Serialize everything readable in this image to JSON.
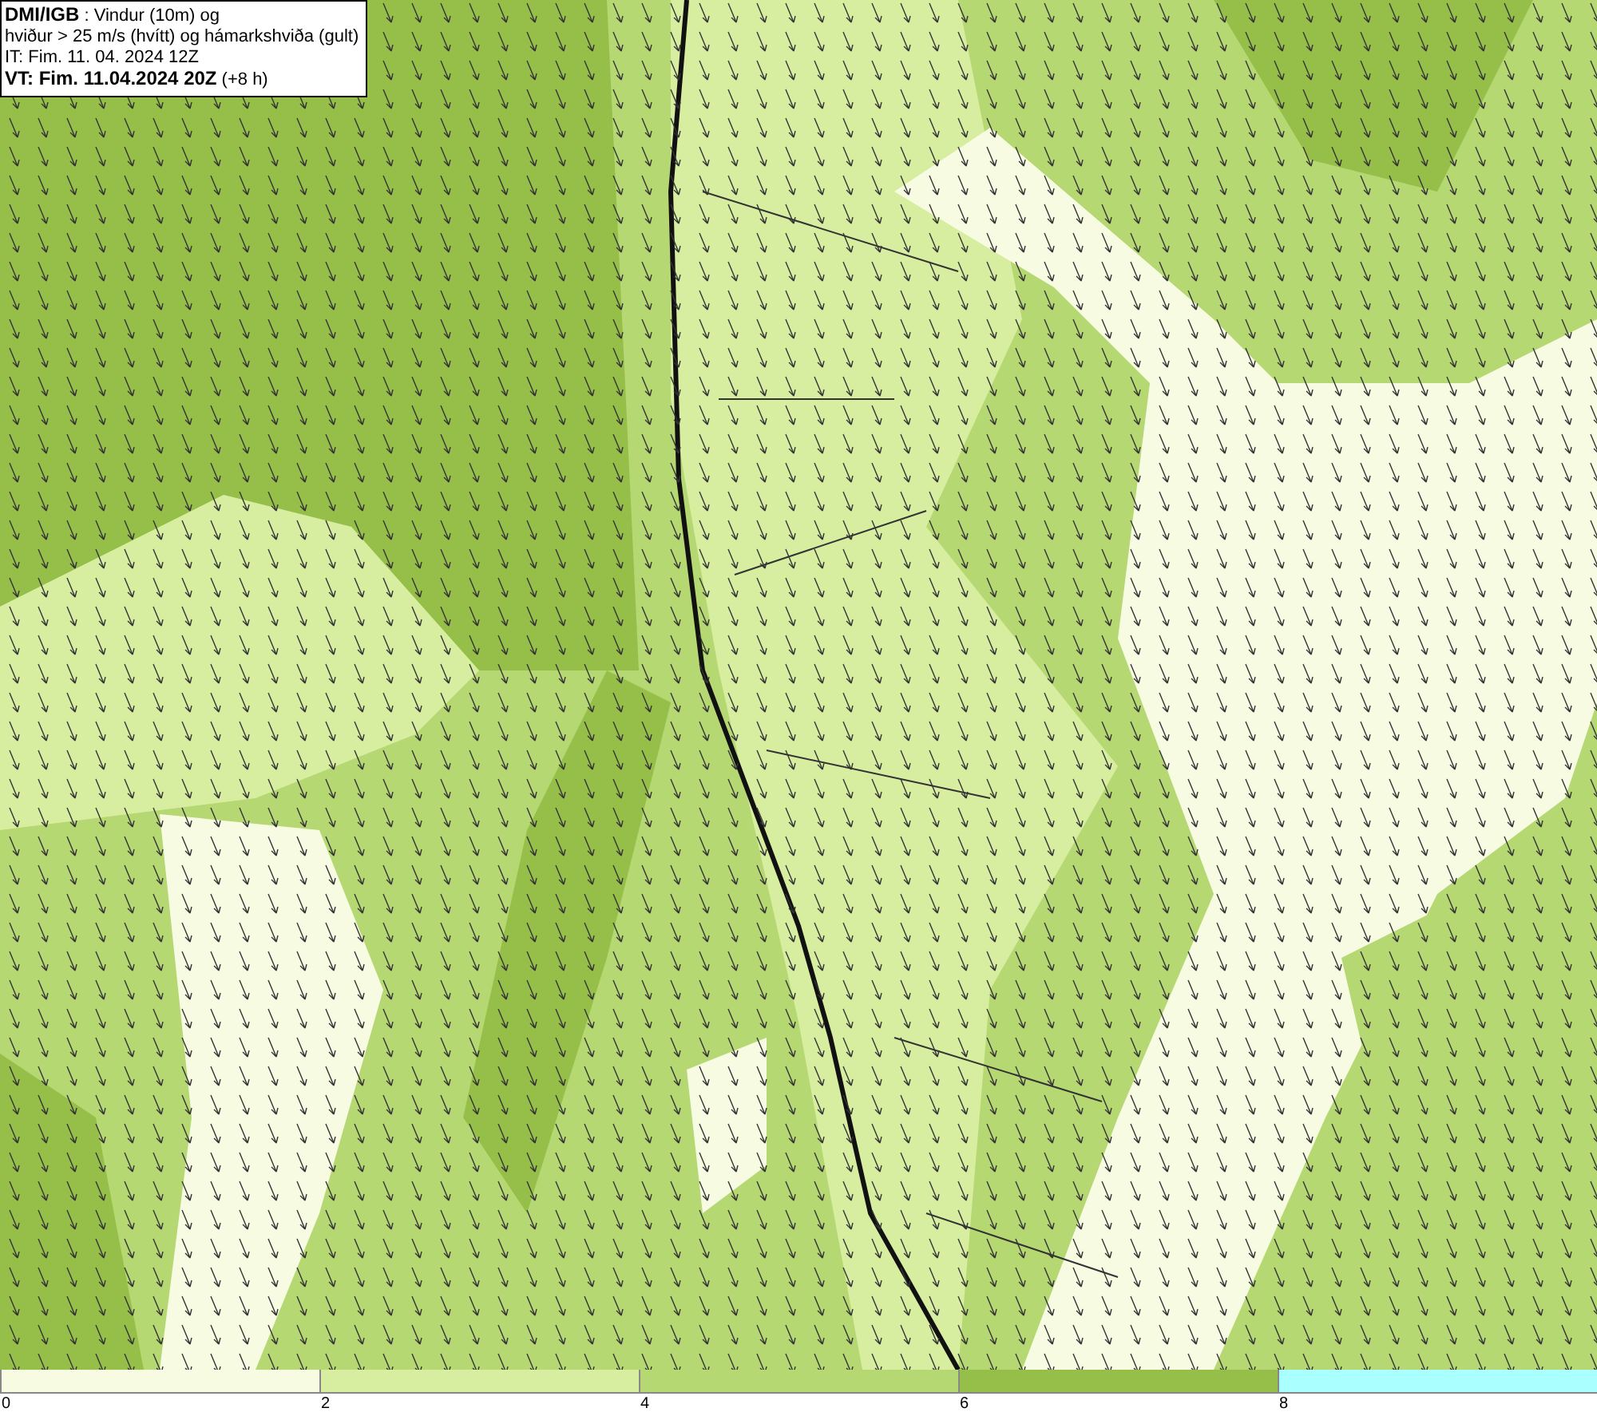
{
  "header": {
    "title": "**DMI/IGB** : Vindur (10m) og",
    "subtitle": "hviður > 25 m/s (hvítt) og hámarkshviða (gult)",
    "issue_time": "IT: Fim. 11. 04. 2024 12Z",
    "valid_time": "**VT: Fim. 11.04.2024 20Z** (+8 h)"
  },
  "legend": {
    "bins": [
      {
        "color": "#f7fbe2"
      },
      {
        "color": "#d7eea0"
      },
      {
        "color": "#b5d873"
      },
      {
        "color": "#95bf48"
      },
      {
        "color": "#aaffff"
      }
    ],
    "ticks": [
      "0",
      "2",
      "4",
      "6",
      "8"
    ]
  }
}
